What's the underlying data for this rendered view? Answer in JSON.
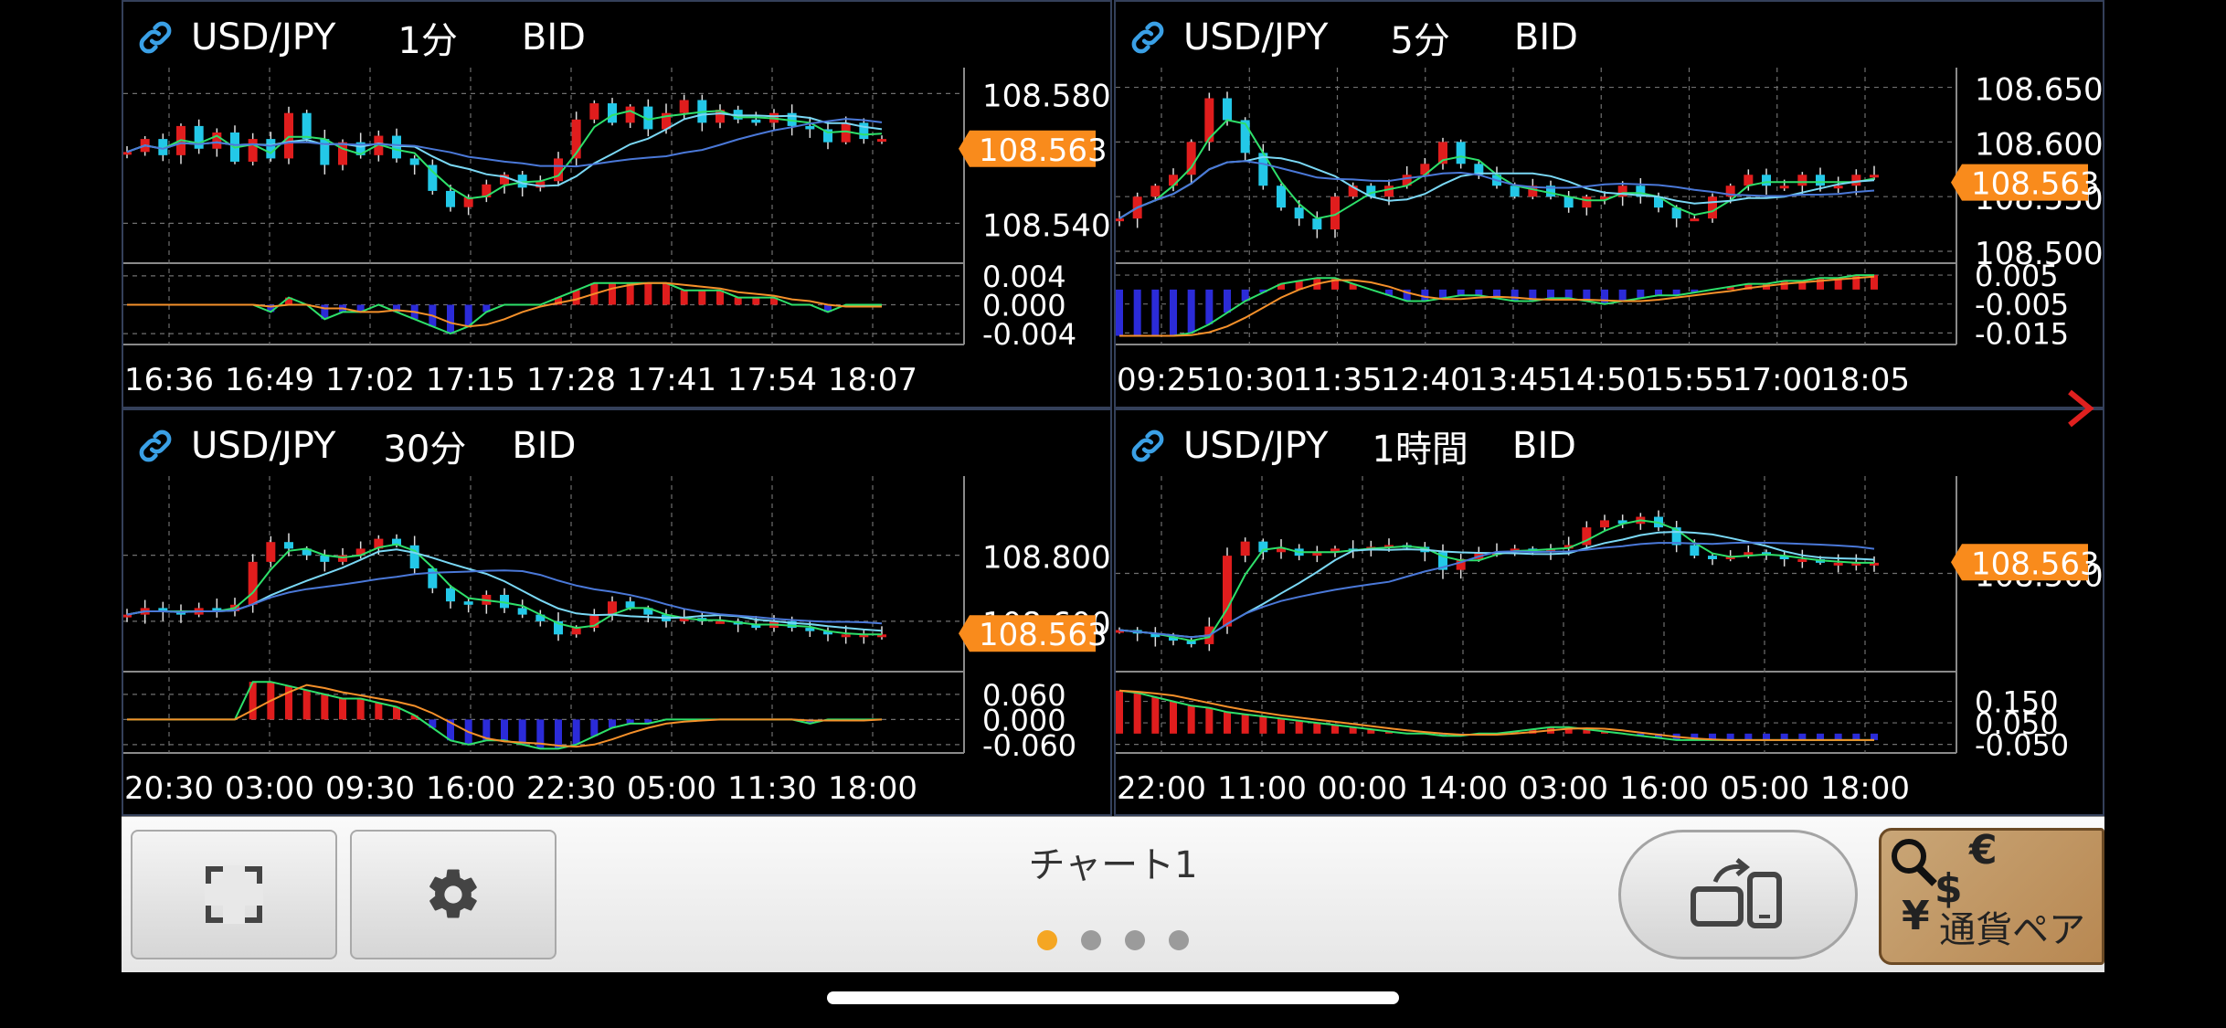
{
  "colors": {
    "background": "#000000",
    "grid": "#6f6f6f",
    "up_candle": "#e01d1d",
    "down_candle": "#23c8e8",
    "ma_short": "#2ee06a",
    "ma_mid": "#7ad8f5",
    "ma_long": "#4a78d8",
    "macd": "#2ee06a",
    "signal": "#f5902a",
    "hist_up": "#e01d1d",
    "hist_down": "#2b2bd8",
    "price_tag": "#f98b1c",
    "accent_dot": "#f5a623"
  },
  "current_price": "108.563",
  "panels": [
    {
      "symbol": "USD/JPY",
      "timeframe": "1分",
      "side": "BID",
      "price_labels": [
        "108.580",
        "108.540"
      ],
      "price_axis": {
        "min": 108.528,
        "max": 108.588,
        "labels": [
          108.58,
          108.54
        ]
      },
      "osc_labels": [
        "0.004",
        "0.000",
        "-0.004"
      ],
      "osc_axis": {
        "min": -0.0055,
        "max": 0.0055,
        "labels": [
          0.004,
          0.0,
          -0.004
        ]
      },
      "time_labels": [
        "16:36",
        "16:49",
        "17:02",
        "17:15",
        "17:28",
        "17:41",
        "17:54",
        "18:07"
      ],
      "series_shape": [
        108.562,
        108.566,
        108.561,
        108.57,
        108.563,
        108.568,
        108.559,
        108.566,
        108.56,
        108.574,
        108.566,
        108.558,
        108.565,
        108.561,
        108.567,
        108.56,
        108.558,
        108.55,
        108.545,
        108.548,
        108.552,
        108.555,
        108.551,
        108.553,
        108.56,
        108.572,
        108.577,
        108.571,
        108.576,
        108.569,
        108.574,
        108.578,
        108.571,
        108.575,
        108.572,
        108.571,
        108.574,
        108.57,
        108.569,
        108.565,
        108.571,
        108.566,
        108.566
      ],
      "osc_shape": [
        0.0,
        0.0,
        0.0,
        0.0,
        0.0,
        0.0,
        0.0,
        0.0,
        -0.001,
        0.001,
        0.0,
        -0.002,
        -0.001,
        -0.001,
        0.0,
        -0.001,
        -0.002,
        -0.003,
        -0.004,
        -0.003,
        -0.001,
        0.0,
        0.0,
        0.0,
        0.001,
        0.002,
        0.003,
        0.003,
        0.003,
        0.003,
        0.003,
        0.002,
        0.002,
        0.002,
        0.001,
        0.001,
        0.001,
        0.0,
        0.0,
        -0.001,
        0.0,
        0.0,
        0.0
      ],
      "has_tag_overlap": true
    },
    {
      "symbol": "USD/JPY",
      "timeframe": "5分",
      "side": "BID",
      "price_labels": [
        "108.650",
        "108.600",
        "108.550",
        "108.500"
      ],
      "price_axis": {
        "min": 108.49,
        "max": 108.668,
        "labels": [
          108.65,
          108.6,
          108.55,
          108.5
        ]
      },
      "osc_labels": [
        "0.005",
        "-0.005",
        "-0.015"
      ],
      "osc_axis": {
        "min": -0.019,
        "max": 0.0085,
        "labels": [
          0.005,
          -0.005,
          -0.015
        ]
      },
      "time_labels": [
        "09:25",
        "10:30",
        "11:35",
        "12:40",
        "13:45",
        "14:50",
        "15:55",
        "17:00",
        "18:05"
      ],
      "series_shape": [
        108.53,
        108.55,
        108.56,
        108.57,
        108.6,
        108.64,
        108.62,
        108.59,
        108.56,
        108.54,
        108.53,
        108.52,
        108.55,
        108.56,
        108.55,
        108.56,
        108.57,
        108.58,
        108.6,
        108.58,
        108.57,
        108.56,
        108.55,
        108.56,
        108.55,
        108.54,
        108.55,
        108.55,
        108.56,
        108.55,
        108.54,
        108.53,
        108.53,
        108.55,
        108.56,
        108.57,
        108.56,
        108.56,
        108.57,
        108.56,
        108.56,
        108.57,
        108.57
      ],
      "osc_shape": [
        -0.016,
        -0.016,
        -0.016,
        -0.016,
        -0.015,
        -0.012,
        -0.008,
        -0.004,
        -0.001,
        0.002,
        0.003,
        0.004,
        0.004,
        0.002,
        0.0,
        -0.002,
        -0.004,
        -0.004,
        -0.003,
        -0.002,
        -0.002,
        -0.003,
        -0.004,
        -0.004,
        -0.003,
        -0.003,
        -0.004,
        -0.005,
        -0.004,
        -0.003,
        -0.002,
        -0.002,
        -0.001,
        0.0,
        0.001,
        0.002,
        0.002,
        0.003,
        0.003,
        0.004,
        0.004,
        0.005,
        0.005
      ],
      "has_tag_overlap": true
    },
    {
      "symbol": "USD/JPY",
      "timeframe": "30分",
      "side": "BID",
      "price_labels": [
        "108.800",
        "108.600"
      ],
      "price_axis": {
        "min": 108.45,
        "max": 109.04,
        "labels": [
          108.8,
          108.6
        ]
      },
      "osc_labels": [
        "0.060",
        "0.000",
        "-0.060"
      ],
      "osc_axis": {
        "min": -0.08,
        "max": 0.11,
        "labels": [
          0.06,
          0.0,
          -0.06
        ]
      },
      "time_labels": [
        "20:30",
        "03:00",
        "09:30",
        "16:00",
        "22:30",
        "05:00",
        "11:30",
        "18:00"
      ],
      "series_shape": [
        108.62,
        108.64,
        108.63,
        108.62,
        108.64,
        108.63,
        108.65,
        108.78,
        108.84,
        108.82,
        108.8,
        108.78,
        108.8,
        108.82,
        108.85,
        108.83,
        108.76,
        108.7,
        108.66,
        108.65,
        108.68,
        108.64,
        108.62,
        108.6,
        108.56,
        108.58,
        108.62,
        108.66,
        108.64,
        108.62,
        108.6,
        108.61,
        108.6,
        108.6,
        108.59,
        108.58,
        108.6,
        108.58,
        108.57,
        108.56,
        108.56,
        108.56,
        108.56
      ],
      "osc_shape": [
        0.0,
        0.0,
        0.0,
        0.0,
        0.0,
        0.0,
        0.0,
        0.09,
        0.09,
        0.08,
        0.07,
        0.06,
        0.05,
        0.05,
        0.04,
        0.03,
        0.01,
        -0.02,
        -0.05,
        -0.06,
        -0.05,
        -0.05,
        -0.06,
        -0.07,
        -0.07,
        -0.06,
        -0.04,
        -0.02,
        -0.01,
        -0.01,
        0.0,
        0.0,
        0.0,
        0.0,
        0.0,
        0.0,
        0.0,
        0.0,
        -0.01,
        0.0,
        0.0,
        0.0,
        0.0
      ],
      "has_tag_overlap": true
    },
    {
      "symbol": "USD/JPY",
      "timeframe": "1時間",
      "side": "BID",
      "price_labels": [
        "108.500"
      ],
      "price_axis": {
        "min": 107.95,
        "max": 109.05,
        "labels": [
          108.5
        ]
      },
      "osc_labels": [
        "0.150",
        "0.050",
        "-0.050"
      ],
      "osc_axis": {
        "min": -0.09,
        "max": 0.28,
        "labels": [
          0.15,
          0.05,
          -0.05
        ]
      },
      "time_labels": [
        "22:00",
        "11:00",
        "00:00",
        "14:00",
        "03:00",
        "16:00",
        "05:00",
        "18:00"
      ],
      "series_shape": [
        108.18,
        108.16,
        108.14,
        108.12,
        108.1,
        108.2,
        108.6,
        108.68,
        108.62,
        108.64,
        108.6,
        108.62,
        108.64,
        108.63,
        108.65,
        108.66,
        108.65,
        108.62,
        108.52,
        108.58,
        108.62,
        108.62,
        108.64,
        108.63,
        108.64,
        108.66,
        108.76,
        108.8,
        108.78,
        108.82,
        108.76,
        108.66,
        108.6,
        108.58,
        108.6,
        108.62,
        108.6,
        108.58,
        108.58,
        108.56,
        108.56,
        108.56,
        108.56
      ],
      "osc_shape": [
        0.2,
        0.19,
        0.17,
        0.15,
        0.13,
        0.12,
        0.1,
        0.09,
        0.08,
        0.07,
        0.06,
        0.05,
        0.04,
        0.03,
        0.02,
        0.01,
        0.0,
        0.0,
        -0.01,
        -0.01,
        0.0,
        0.0,
        0.01,
        0.02,
        0.03,
        0.03,
        0.02,
        0.01,
        0.0,
        -0.01,
        -0.02,
        -0.03,
        -0.03,
        -0.03,
        -0.03,
        -0.03,
        -0.03,
        -0.03,
        -0.03,
        -0.03,
        -0.03,
        -0.03,
        -0.03
      ],
      "has_tag_overlap": true
    }
  ],
  "bottom_bar": {
    "title": "チャート1",
    "fullscreen_icon": "fullscreen-icon",
    "settings_icon": "gear-icon",
    "rotate_icon": "rotate-device-icon",
    "page_count": 4,
    "active_page": 0,
    "currency_button": {
      "label": "通貨ペア",
      "symbols": [
        "€",
        "$",
        "¥"
      ]
    }
  },
  "next_arrow_icon": "chevron-right-icon"
}
